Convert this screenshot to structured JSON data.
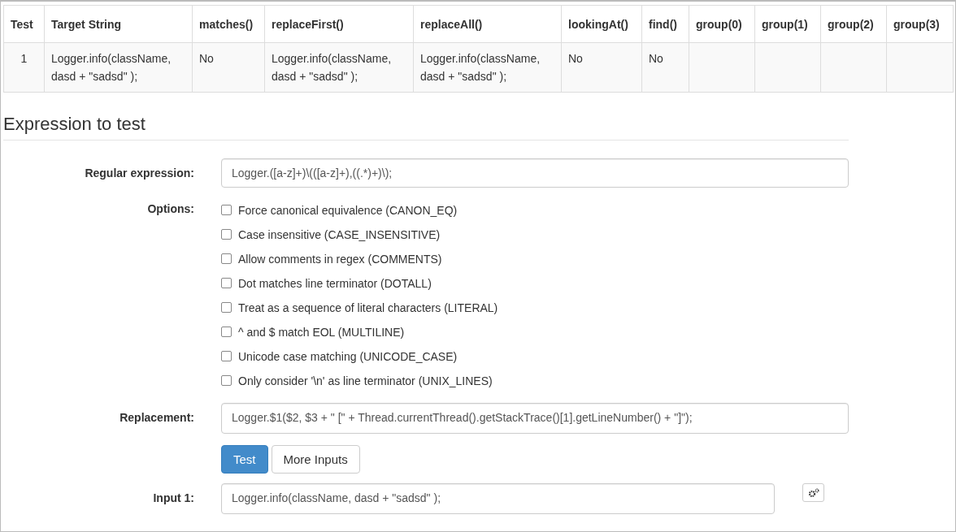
{
  "results_table": {
    "columns": [
      "Test",
      "Target String",
      "matches()",
      "replaceFirst()",
      "replaceAll()",
      "lookingAt()",
      "find()",
      "group(0)",
      "group(1)",
      "group(2)",
      "group(3)"
    ],
    "rows": [
      [
        "1",
        "Logger.info(className, dasd + \"sadsd\" );",
        "No",
        "Logger.info(className, dasd + \"sadsd\" );",
        "Logger.info(className, dasd + \"sadsd\" );",
        "No",
        "No",
        "",
        "",
        "",
        ""
      ]
    ]
  },
  "section_title": "Expression to test",
  "regex": {
    "label": "Regular expression:",
    "value": "Logger.([a-z]+)\\(([a-z]+),((.*)+)\\);"
  },
  "options": {
    "label": "Options:",
    "items": [
      {
        "label": "Force canonical equivalence (CANON_EQ)",
        "checked": false
      },
      {
        "label": "Case insensitive (CASE_INSENSITIVE)",
        "checked": false
      },
      {
        "label": "Allow comments in regex (COMMENTS)",
        "checked": false
      },
      {
        "label": "Dot matches line terminator (DOTALL)",
        "checked": false
      },
      {
        "label": "Treat as a sequence of literal characters (LITERAL)",
        "checked": false
      },
      {
        "label": "^ and $ match EOL (MULTILINE)",
        "checked": false
      },
      {
        "label": "Unicode case matching (UNICODE_CASE)",
        "checked": false
      },
      {
        "label": "Only consider '\\n' as line terminator (UNIX_LINES)",
        "checked": false
      }
    ]
  },
  "replacement": {
    "label": "Replacement:",
    "value": "Logger.$1($2, $3 + \" [\" + Thread.currentThread().getStackTrace()[1].getLineNumber() + \"]\");"
  },
  "buttons": [
    {
      "label": "Test",
      "kind": "primary"
    },
    {
      "label": "More Inputs",
      "kind": "default"
    }
  ],
  "inputs": [
    {
      "label": "Input 1:",
      "value": "Logger.info(className, dasd + \"sadsd\" );"
    }
  ]
}
